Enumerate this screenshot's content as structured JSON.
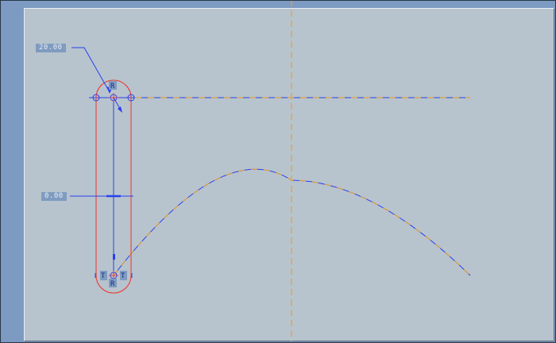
{
  "dimensions": {
    "top": "20.00",
    "middle": "0.00"
  },
  "constraint_markers": {
    "radius_top": "R",
    "radius_bottom": "R",
    "tangent_left": "T",
    "tangent_right": "T"
  },
  "colors": {
    "background": "#b7c4cd",
    "frame": "#7d9ac2",
    "centerline": "#e0a040",
    "sketch_blue": "#2a3ff0",
    "slot_red": "#e8403a",
    "dim_box": "#7f9bbf"
  }
}
